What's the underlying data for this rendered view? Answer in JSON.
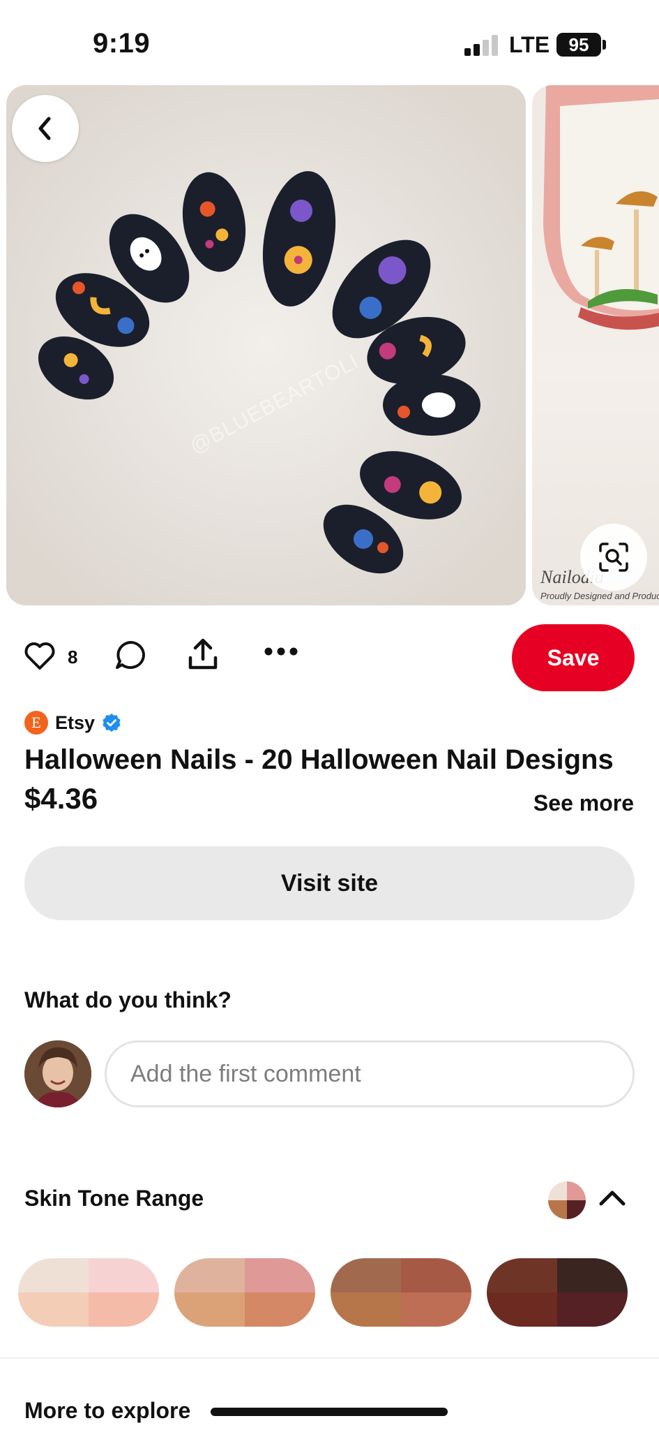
{
  "status_bar": {
    "time": "9:19",
    "network": "LTE",
    "battery": "95"
  },
  "hero": {
    "watermark": "@BLUEBEARTOLI"
  },
  "next_pin": {
    "brand": "Nailodia",
    "tagline": "Proudly Designed and Produced"
  },
  "actions": {
    "like_count": "8",
    "save_label": "Save"
  },
  "pin": {
    "source": "Etsy",
    "source_logo_letter": "E",
    "title": "Halloween Nails - 20 Halloween Nail Designs",
    "price": "$4.36",
    "see_more": "See more",
    "visit_label": "Visit site"
  },
  "comments": {
    "heading": "What do you think?",
    "placeholder": "Add the first comment"
  },
  "skin_tone": {
    "heading": "Skin Tone Range",
    "swatches": [
      [
        "#efe0d6",
        "#f6d3d2",
        "#f4cdb6",
        "#f3bba8"
      ],
      [
        "#dfb29d",
        "#df9996",
        "#dba277",
        "#d48865"
      ],
      [
        "#a16a4e",
        "#a65a45",
        "#b6764a",
        "#bf6e56"
      ],
      [
        "#6e3526",
        "#3b2520",
        "#6c2a20",
        "#552125"
      ]
    ]
  },
  "more_to_explore": "More to explore",
  "colors": {
    "accent": "#e60023",
    "verified": "#1d8ff0",
    "etsy": "#f1641e"
  }
}
